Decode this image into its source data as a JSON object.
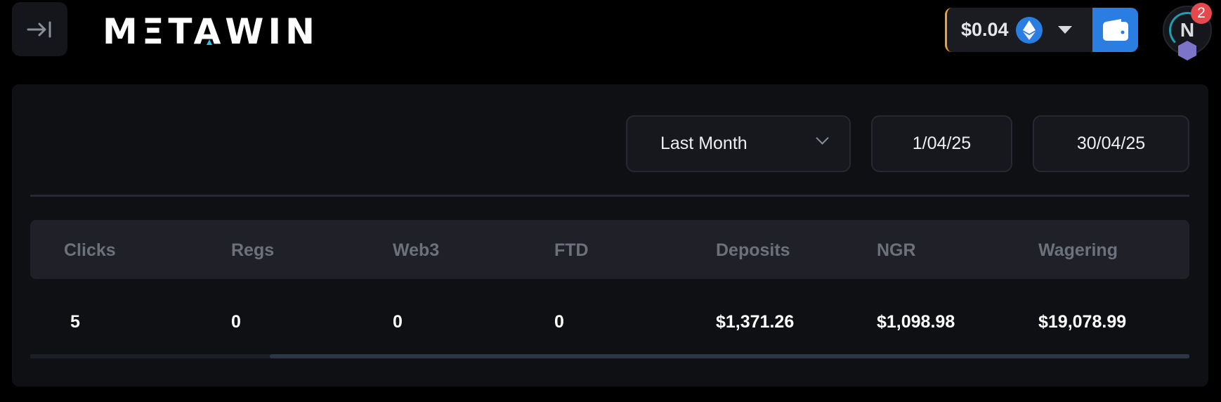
{
  "header": {
    "logo_text": "METAWIN",
    "balance": "$0.04",
    "currency_icon": "ethereum-icon",
    "avatar_initial": "N",
    "notification_count": "2",
    "colors": {
      "accent": "#2a7de1",
      "badge": "#e5484d",
      "balance_edge": "#e9a23b"
    }
  },
  "filters": {
    "period": "Last Month",
    "start_date": "1/04/25",
    "end_date": "30/04/25"
  },
  "table": {
    "columns": [
      "Clicks",
      "Regs",
      "Web3",
      "FTD",
      "Deposits",
      "NGR",
      "Wagering"
    ],
    "rows": [
      [
        "5",
        "0",
        "0",
        "0",
        "$1,371.26",
        "$1,098.98",
        "$19,078.99"
      ]
    ]
  }
}
